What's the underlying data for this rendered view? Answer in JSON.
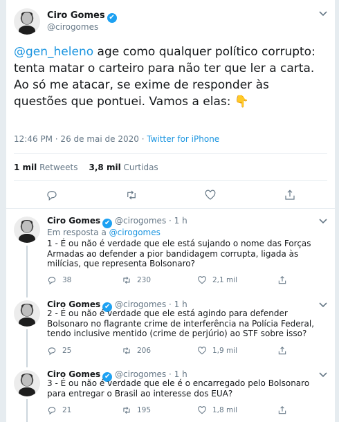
{
  "main_tweet": {
    "author_name": "Ciro Gomes",
    "author_handle": "@cirogomes",
    "verified_badge": "✔",
    "mention": "@gen_heleno",
    "text": " age como qualquer político corrupto: tenta matar o carteiro para não ter que ler a carta. Ao só me atacar, se exime de responder às questões que pontuei. Vamos a elas: 👇",
    "timestamp": "12:46 PM · 26 de mai de 2020 · ",
    "source": "Twitter for iPhone",
    "retweets_count": "1 mil",
    "retweets_label": " Retweets",
    "likes_count": "3,8 mil",
    "likes_label": " Curtidas"
  },
  "replies": [
    {
      "author_name": "Ciro Gomes",
      "author_handle": "@cirogomes · 1 h",
      "in_reply_prefix": "Em resposta a ",
      "in_reply_handle": "@cirogomes",
      "text": "1 - É ou não é verdade que ele está sujando o nome das Forças Armadas ao defender a pior bandidagem corrupta, ligada às milícias, que representa Bolsonaro?",
      "replies": "38",
      "retweets": "230",
      "likes": "2,1 mil"
    },
    {
      "author_name": "Ciro Gomes",
      "author_handle": "@cirogomes · 1 h",
      "text": "2 - É ou não é verdade que ele está agindo para defender Bolsonaro no flagrante crime de interferência na Polícia Federal, tendo inclusive mentido (crime de perjúrio) ao STF sobre isso?",
      "replies": "25",
      "retweets": "206",
      "likes": "1,9 mil"
    },
    {
      "author_name": "Ciro Gomes",
      "author_handle": "@cirogomes · 1 h",
      "text": "3 - É ou não é verdade que ele é o encarregado pelo Bolsonaro para entregar o Brasil ao interesse dos EUA?",
      "replies": "21",
      "retweets": "195",
      "likes": "1,8 mil"
    }
  ],
  "icons": {
    "more": "chevron-down-icon",
    "reply": "reply-icon",
    "retweet": "retweet-icon",
    "like": "heart-icon",
    "share": "share-icon"
  },
  "colors": {
    "link": "#1b95e0",
    "verified": "#1da1f2",
    "muted": "#657786"
  }
}
